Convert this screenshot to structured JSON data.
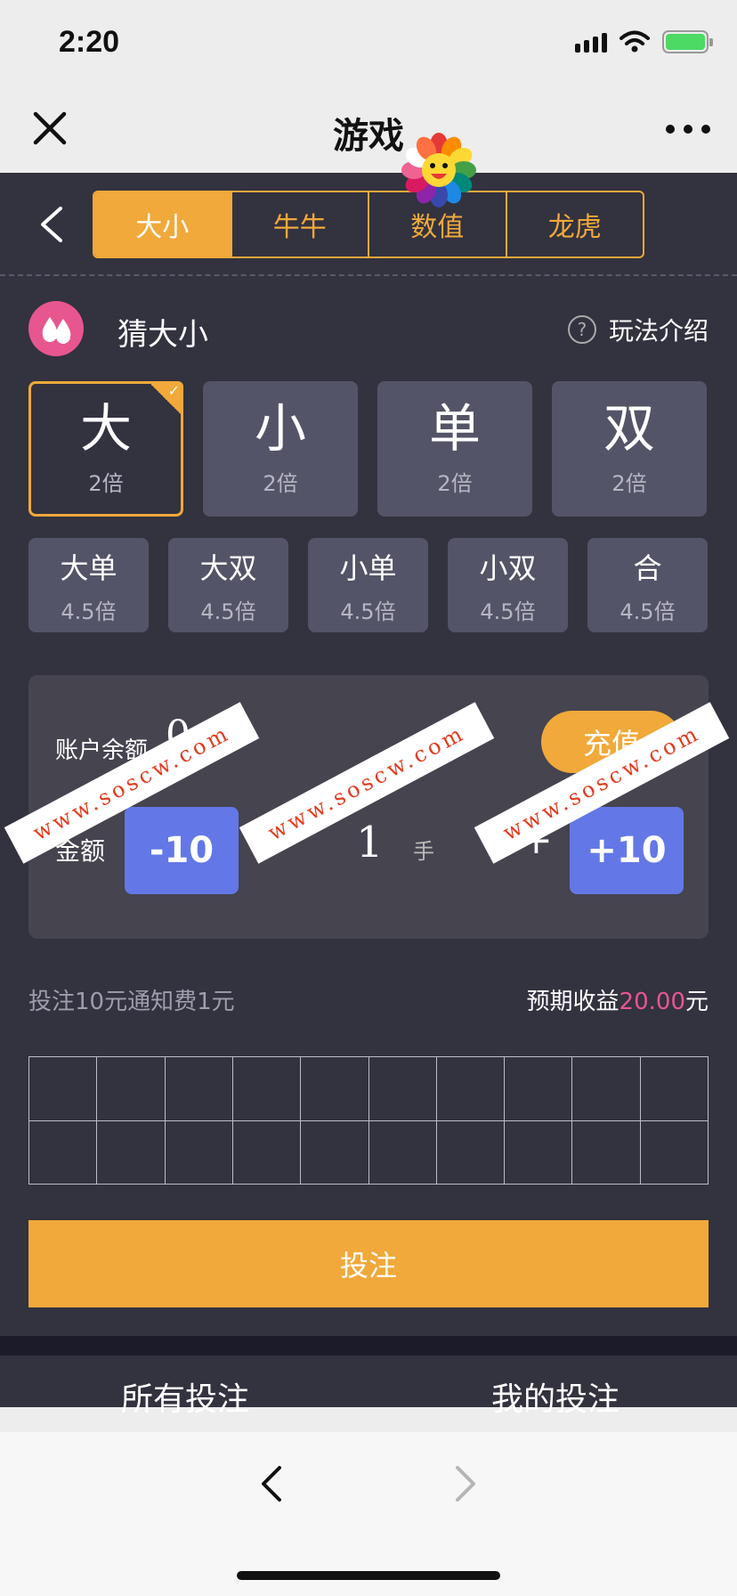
{
  "status": {
    "time": "2:20"
  },
  "nav": {
    "title": "游戏"
  },
  "top_tabs": [
    "大小",
    "牛牛",
    "数值",
    "龙虎"
  ],
  "section": {
    "title": "猜大小",
    "help_label": "玩法介绍",
    "help_mark": "?"
  },
  "big_options": [
    {
      "label": "大",
      "odds": "2倍"
    },
    {
      "label": "小",
      "odds": "2倍"
    },
    {
      "label": "单",
      "odds": "2倍"
    },
    {
      "label": "双",
      "odds": "2倍"
    }
  ],
  "small_options": [
    {
      "label": "大单",
      "odds": "4.5倍"
    },
    {
      "label": "大双",
      "odds": "4.5倍"
    },
    {
      "label": "小单",
      "odds": "4.5倍"
    },
    {
      "label": "小双",
      "odds": "4.5倍"
    },
    {
      "label": "合",
      "odds": "4.5倍"
    }
  ],
  "account": {
    "balance_label": "账户余额",
    "balance_value": "0",
    "recharge_label": "充值",
    "amount_label": "金额",
    "minus10_label": "-10",
    "minus_label": "-",
    "quantity": "1",
    "unit": "手",
    "plus_label": "+",
    "plus10_label": "+10"
  },
  "fee_note": "投注10元通知费1元",
  "expected": {
    "label": "预期收益",
    "value": "20.00",
    "unit": "元"
  },
  "bet_button": "投注",
  "bottom_tabs": [
    "所有投注",
    "我的投注"
  ],
  "watermark_text": "www.soscw.com",
  "colors": {
    "accent": "#f0a93a",
    "panel": "#33323f",
    "step_button": "#6378e6",
    "highlight": "#e8568f"
  }
}
